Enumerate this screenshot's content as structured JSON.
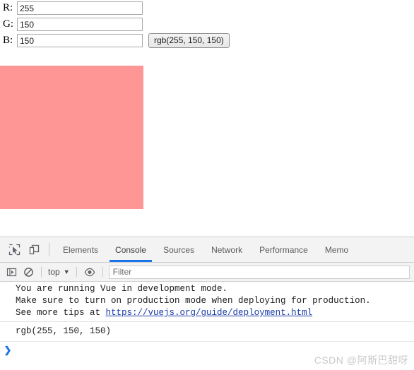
{
  "page": {
    "fields": [
      {
        "label": "R:",
        "name": "r",
        "value": "255"
      },
      {
        "label": "G:",
        "name": "g",
        "value": "150"
      },
      {
        "label": "B:",
        "name": "b",
        "value": "150"
      }
    ],
    "rgb_button_label": "rgb(255, 150, 150)",
    "swatch_color": "#ff9696"
  },
  "devtools": {
    "icons": {
      "inspect": "inspect-element-icon",
      "device": "device-toolbar-icon",
      "sidebar": "console-sidebar-icon",
      "clear": "clear-console-icon",
      "eye": "live-expression-eye-icon",
      "chevron": "chevron-down-icon"
    },
    "tabs": [
      {
        "label": "Elements",
        "active": false
      },
      {
        "label": "Console",
        "active": true
      },
      {
        "label": "Sources",
        "active": false
      },
      {
        "label": "Network",
        "active": false
      },
      {
        "label": "Performance",
        "active": false
      },
      {
        "label": "Memo",
        "active": false
      }
    ],
    "active_tab": "Console",
    "accent_color": "#1a73e8",
    "filterbar": {
      "context": "top",
      "chevron": "▼",
      "filter_placeholder": "Filter",
      "filter_value": ""
    },
    "console": {
      "messages": [
        {
          "type": "group",
          "lines": [
            {
              "text": "You are running Vue in development mode."
            },
            {
              "text": "Make sure to turn on production mode when deploying for production."
            },
            {
              "prefix": "See more tips at ",
              "link": "https://vuejs.org/guide/deployment.html"
            }
          ]
        },
        {
          "type": "output",
          "text": "rgb(255, 150, 150)"
        }
      ],
      "prompt_chevron": "❯",
      "prompt_value": ""
    }
  },
  "watermark": "CSDN @阿斯巴甜呀"
}
